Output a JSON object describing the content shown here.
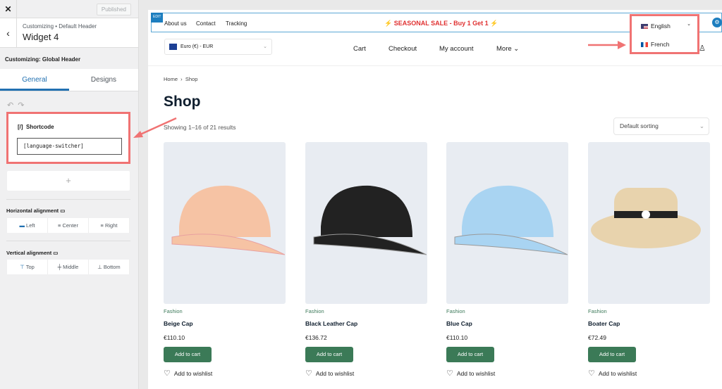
{
  "sidebar": {
    "published": "Published",
    "breadcrumb": "Customizing • Default Header",
    "title": "Widget 4",
    "section": "Customizing: Global Header",
    "tabs": [
      "General",
      "Designs"
    ],
    "shortcode_title": "Shortcode",
    "shortcode_icon": "[/]",
    "shortcode_value": "[language-switcher]",
    "horizontal_label": "Horizontal alignment",
    "horizontal_options": [
      "Left",
      "Center",
      "Right"
    ],
    "vertical_label": "Vertical alignment",
    "vertical_options": [
      "Top",
      "Middle",
      "Bottom"
    ]
  },
  "preview": {
    "edit": "EDIT",
    "top_links": [
      "About us",
      "Contact",
      "Tracking"
    ],
    "sale": "SEASONAL SALE - Buy 1 Get 1",
    "languages": [
      "English",
      "French"
    ],
    "currency": "Euro (€) - EUR",
    "nav": [
      "Cart",
      "Checkout",
      "My account",
      "More"
    ],
    "breadcrumb": [
      "Home",
      "Shop"
    ],
    "title": "Shop",
    "results": "Showing 1–16 of 21 results",
    "sorting": "Default sorting",
    "products": [
      {
        "category": "Fashion",
        "name": "Beige Cap",
        "price": "€110.10",
        "color": "#f6c3a4"
      },
      {
        "category": "Fashion",
        "name": "Black Leather Cap",
        "price": "€136.72",
        "color": "#222222"
      },
      {
        "category": "Fashion",
        "name": "Blue Cap",
        "price": "€110.10",
        "color": "#a9d4f2"
      },
      {
        "category": "Fashion",
        "name": "Boater Cap",
        "price": "€72.49",
        "color": "#e8d3ad"
      }
    ],
    "add_to_cart": "Add to cart",
    "wishlist": "Add to wishlist"
  },
  "colors": {
    "accent": "#2271b1",
    "highlight": "#f07373",
    "button": "#3b7a57",
    "sale": "#e03131"
  }
}
